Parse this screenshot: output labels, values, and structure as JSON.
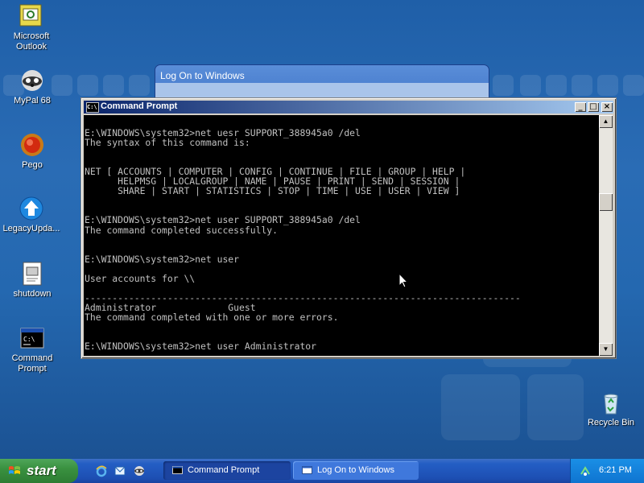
{
  "desktop_icons": [
    {
      "name": "Microsoft Outlook",
      "icon": "outlook-icon"
    },
    {
      "name": "MyPal 68",
      "icon": "raccoon-browser-icon"
    },
    {
      "name": "Pego",
      "icon": "pego-icon"
    },
    {
      "name": "LegacyUpda...",
      "icon": "update-arrow-icon"
    },
    {
      "name": "shutdown",
      "icon": "batch-file-icon"
    },
    {
      "name": "Command Prompt",
      "icon": "cmd-icon"
    },
    {
      "name": "Recycle Bin",
      "icon": "recycle-bin-icon"
    }
  ],
  "logon_window": {
    "title": "Log On to Windows"
  },
  "cmd_window": {
    "title": "Command Prompt",
    "icon_text": "C:\\",
    "buttons": {
      "minimize": "_",
      "maximize": "□",
      "close": "×"
    },
    "lines": [
      "",
      "E:\\WINDOWS\\system32>net uesr SUPPORT_388945a0 /del",
      "The syntax of this command is:",
      "",
      "",
      "NET [ ACCOUNTS | COMPUTER | CONFIG | CONTINUE | FILE | GROUP | HELP |",
      "      HELPMSG | LOCALGROUP | NAME | PAUSE | PRINT | SEND | SESSION |",
      "      SHARE | START | STATISTICS | STOP | TIME | USE | USER | VIEW ]",
      "",
      "",
      "E:\\WINDOWS\\system32>net user SUPPORT_388945a0 /del",
      "The command completed successfully.",
      "",
      "",
      "E:\\WINDOWS\\system32>net user",
      "",
      "User accounts for \\\\",
      "",
      "-------------------------------------------------------------------------------",
      "Administrator             Guest",
      "The command completed with one or more errors.",
      "",
      "",
      "E:\\WINDOWS\\system32>net user Administrator"
    ]
  },
  "taskbar": {
    "start_label": "start",
    "quick_launch": [
      "ie-icon",
      "outlook-express-icon",
      "raccoon-browser-icon"
    ],
    "tasks": [
      {
        "label": "Command Prompt",
        "active": true
      },
      {
        "label": "Log On to Windows",
        "active": false
      }
    ],
    "clock": "6:21 PM"
  },
  "colors": {
    "console_bg": "#000000",
    "console_text": "#c0c0c0",
    "desktop": "#2468b0",
    "start_green": "#3a9140"
  }
}
